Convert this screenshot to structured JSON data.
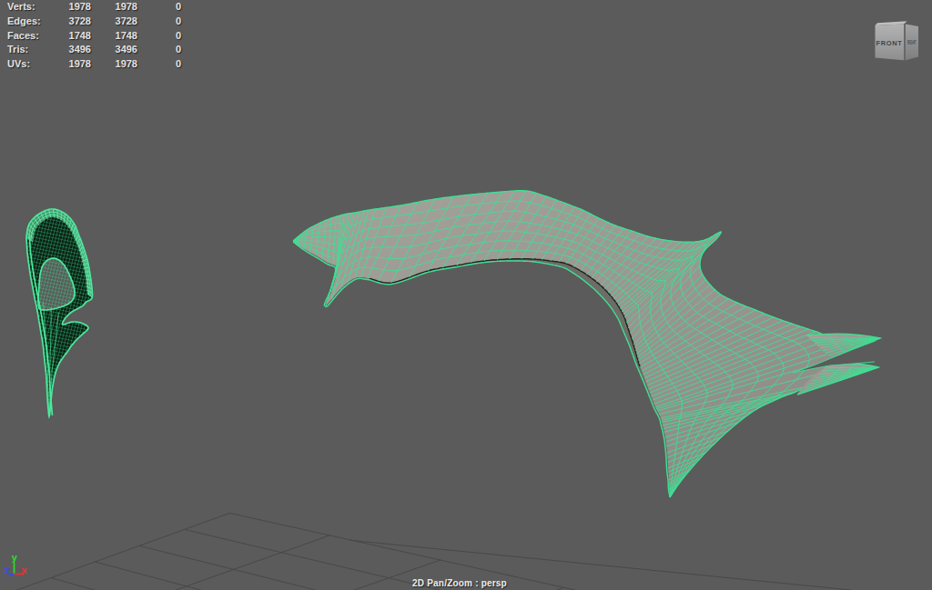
{
  "hud": {
    "rows": [
      {
        "label": "Verts:",
        "v1": "1978",
        "v2": "1978",
        "v3": "0"
      },
      {
        "label": "Edges:",
        "v1": "3728",
        "v2": "3728",
        "v3": "0"
      },
      {
        "label": "Faces:",
        "v1": "1748",
        "v2": "1748",
        "v3": "0"
      },
      {
        "label": "Tris:",
        "v1": "3496",
        "v2": "3496",
        "v3": "0"
      },
      {
        "label": "UVs:",
        "v1": "1978",
        "v2": "1978",
        "v3": "0"
      }
    ]
  },
  "viewcube": {
    "front_label": "FRONT",
    "right_label": "RIGHT"
  },
  "axis": {
    "x_label": "x",
    "y_label": "y",
    "z_label": "z"
  },
  "statusbar": {
    "panzoom_label": "2D Pan/Zoom : persp"
  },
  "colors": {
    "background": "#5b5b5b",
    "grid_line": "#484848",
    "wireframe_green": "#3de092",
    "mesh_fill": "#999690",
    "hud_text": "#e2e2e2",
    "axis_x_red": "#e03535",
    "axis_y_green": "#2fd42f",
    "axis_z_blue": "#3a4fe0"
  }
}
